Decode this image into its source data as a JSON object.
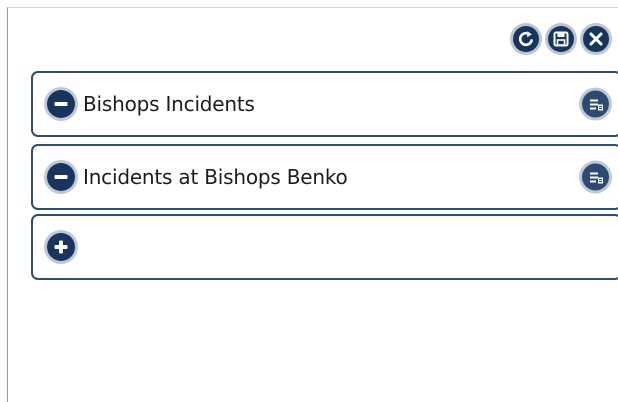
{
  "toolbar": {
    "buttons": [
      {
        "icon": "refresh-icon"
      },
      {
        "icon": "save-icon"
      },
      {
        "icon": "close-icon"
      }
    ]
  },
  "queries": [
    {
      "label": "Bishops Incidents",
      "lead_icon": "minus-icon",
      "trail_icon": "list-icon"
    },
    {
      "label": "Incidents at Bishops Benko",
      "lead_icon": "minus-icon",
      "trail_icon": "list-icon"
    }
  ],
  "add_row": {
    "lead_icon": "plus-icon"
  },
  "colors": {
    "accent": "#17365f",
    "border": "#2a4d7a",
    "button_ring": "#bfc9d5"
  }
}
